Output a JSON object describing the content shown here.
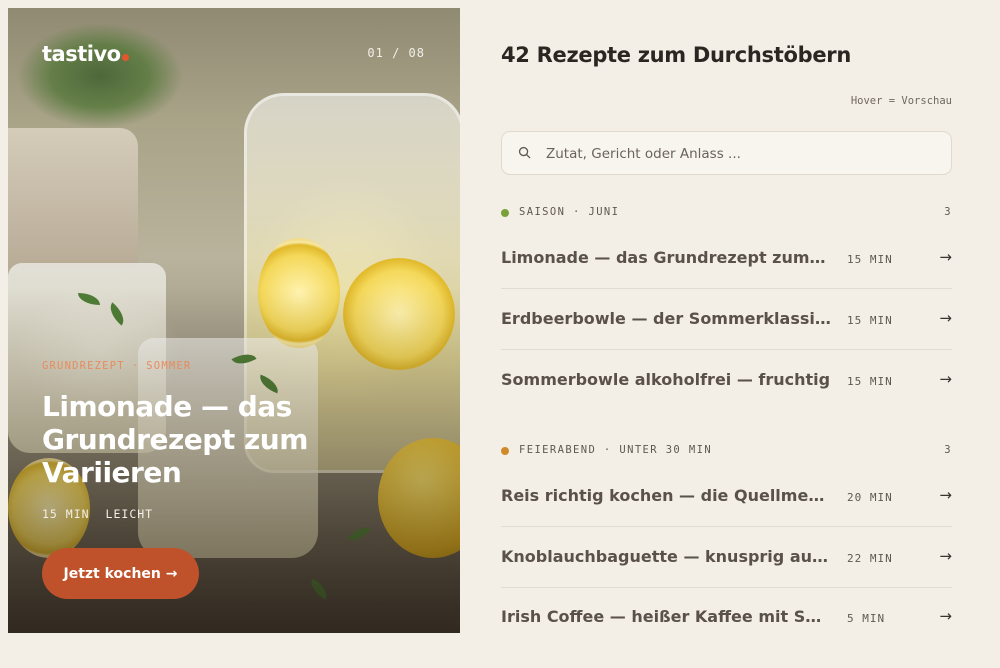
{
  "hero": {
    "logo": "tastivo",
    "counter": "01 / 08",
    "tags": [
      "GRUNDREZEPT",
      "SOMMER"
    ],
    "tag_separator": "·",
    "title": "Limonade — das Grundrezept zum Variieren",
    "time": "15 MIN",
    "difficulty": "LEICHT",
    "cta_label": "Jetzt kochen →"
  },
  "list": {
    "heading": "42 Rezepte zum Durchstöbern",
    "hint": "Hover = Vorschau",
    "search": {
      "placeholder": "Zutat, Gericht oder Anlass ...",
      "value": ""
    },
    "groups": [
      {
        "label": "SAISON · JUNI",
        "count": "3",
        "dot_color": "#7aa03a",
        "items": [
          {
            "title": "Limonade — das Grundrezept zum Variieren",
            "time": "15 MIN",
            "arrow": "→"
          },
          {
            "title": "Erdbeerbowle — der Sommerklassiker",
            "time": "15 MIN",
            "arrow": "→"
          },
          {
            "title": "Sommerbowle alkoholfrei — fruchtig",
            "time": "15 MIN",
            "arrow": "→"
          }
        ]
      },
      {
        "label": "FEIERABEND · UNTER 30 MIN",
        "count": "3",
        "dot_color": "#d08a2a",
        "items": [
          {
            "title": "Reis richtig kochen — die Quellmethode",
            "time": "20 MIN",
            "arrow": "→"
          },
          {
            "title": "Knoblauchbaguette — knusprig aus dem Ofen",
            "time": "22 MIN",
            "arrow": "→"
          },
          {
            "title": "Irish Coffee — heißer Kaffee mit Sahne",
            "time": "5 MIN",
            "arrow": "→"
          }
        ]
      }
    ]
  },
  "colors": {
    "accent": "#c0522b",
    "background": "#f3efe7",
    "logo_dot": "#e4572e"
  }
}
